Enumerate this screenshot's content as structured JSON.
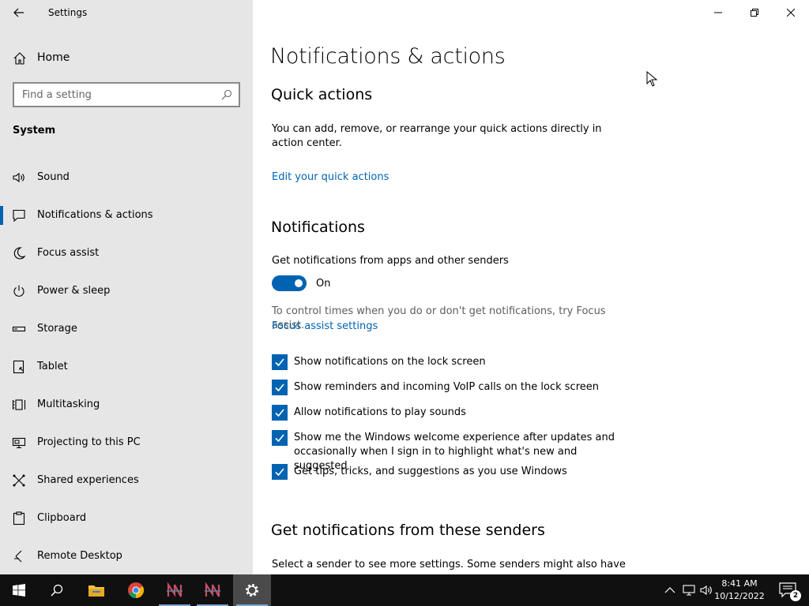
{
  "app": {
    "title": "Settings"
  },
  "sidebar": {
    "home_label": "Home",
    "search_placeholder": "Find a setting",
    "section": "System",
    "items": [
      {
        "label": "Sound",
        "icon": "speaker-icon"
      },
      {
        "label": "Notifications & actions",
        "icon": "notification-icon",
        "active": true
      },
      {
        "label": "Focus assist",
        "icon": "moon-icon"
      },
      {
        "label": "Power & sleep",
        "icon": "power-icon"
      },
      {
        "label": "Storage",
        "icon": "storage-icon"
      },
      {
        "label": "Tablet",
        "icon": "tablet-icon"
      },
      {
        "label": "Multitasking",
        "icon": "multitasking-icon"
      },
      {
        "label": "Projecting to this PC",
        "icon": "projecting-icon"
      },
      {
        "label": "Shared experiences",
        "icon": "shared-experiences-icon"
      },
      {
        "label": "Clipboard",
        "icon": "clipboard-icon"
      },
      {
        "label": "Remote Desktop",
        "icon": "remote-desktop-icon"
      }
    ]
  },
  "main": {
    "page_title": "Notifications & actions",
    "quick_actions": {
      "heading": "Quick actions",
      "description": "You can add, remove, or rearrange your quick actions directly in action center.",
      "link": "Edit your quick actions"
    },
    "notifications": {
      "heading": "Notifications",
      "toggle_label_top": "Get notifications from apps and other senders",
      "toggle_state": "On",
      "focus_hint": "To control times when you do or don't get notifications, try Focus assist.",
      "focus_link": "Focus assist settings",
      "checkboxes": [
        {
          "label": "Show notifications on the lock screen",
          "checked": true
        },
        {
          "label": "Show reminders and incoming VoIP calls on the lock screen",
          "checked": true
        },
        {
          "label": "Allow notifications to play sounds",
          "checked": true
        },
        {
          "label": "Show me the Windows welcome experience after updates and occasionally when I sign in to highlight what's new and suggested",
          "checked": true
        },
        {
          "label": "Get tips, tricks, and suggestions as you use Windows",
          "checked": true
        }
      ]
    },
    "senders": {
      "heading": "Get notifications from these senders",
      "description": "Select a sender to see more settings. Some senders might also have"
    }
  },
  "taskbar": {
    "apps": [
      "start-icon",
      "search-icon",
      "file-explorer-icon",
      "chrome-icon",
      "app-icon-1",
      "app-icon-2",
      "settings-icon"
    ],
    "clock": {
      "time": "8:41 AM",
      "date": "10/12/2022"
    },
    "notification_count": "2"
  },
  "colors": {
    "accent": "#0063b1",
    "sidebar_bg": "#e6e6e6",
    "taskbar_bg": "#101010"
  }
}
